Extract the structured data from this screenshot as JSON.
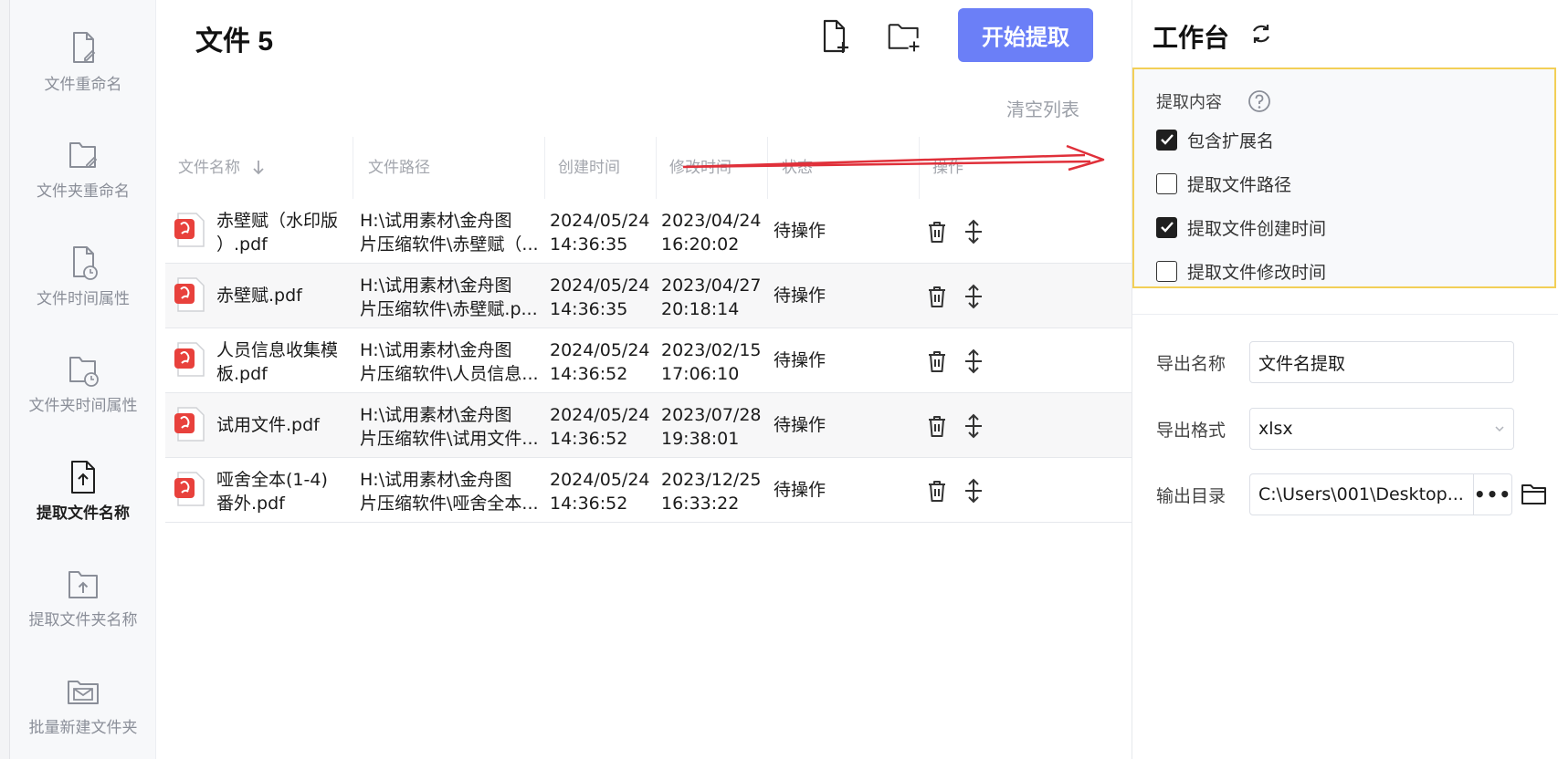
{
  "sidebar": {
    "items": [
      {
        "label": "文件重命名",
        "icon": "file-edit-icon"
      },
      {
        "label": "文件夹重命名",
        "icon": "folder-edit-icon"
      },
      {
        "label": "文件时间属性",
        "icon": "file-clock-icon"
      },
      {
        "label": "文件夹时间属性",
        "icon": "folder-clock-icon"
      },
      {
        "label": "提取文件名称",
        "icon": "file-upload-icon",
        "active": true
      },
      {
        "label": "提取文件夹名称",
        "icon": "folder-upload-icon"
      },
      {
        "label": "批量新建文件夹",
        "icon": "folder-mail-icon"
      }
    ]
  },
  "header": {
    "title": "文件 5",
    "add_file_icon": "add-file-icon",
    "add_folder_icon": "add-folder-icon",
    "start_label": "开始提取",
    "clear_label": "清空列表"
  },
  "table": {
    "columns": [
      "文件名称",
      "文件路径",
      "创建时间",
      "修改时间",
      "状态",
      "操作"
    ],
    "sort_icon": "arrow-down-icon",
    "rows": [
      {
        "name": "赤壁赋（水印版\n）.pdf",
        "path": "H:\\试用素材\\金舟图\n片压缩软件\\赤壁赋（...",
        "created": "2024/05/24\n14:36:35",
        "modified": "2023/04/24\n16:20:02",
        "status": "待操作"
      },
      {
        "name": "赤壁赋.pdf",
        "path": "H:\\试用素材\\金舟图\n片压缩软件\\赤壁赋.p...",
        "created": "2024/05/24\n14:36:35",
        "modified": "2023/04/27\n20:18:14",
        "status": "待操作"
      },
      {
        "name": "人员信息收集模\n板.pdf",
        "path": "H:\\试用素材\\金舟图\n片压缩软件\\人员信息...",
        "created": "2024/05/24\n14:36:52",
        "modified": "2023/02/15\n17:06:10",
        "status": "待操作"
      },
      {
        "name": "试用文件.pdf",
        "path": "H:\\试用素材\\金舟图\n片压缩软件\\试用文件...",
        "created": "2024/05/24\n14:36:52",
        "modified": "2023/07/28\n19:38:01",
        "status": "待操作"
      },
      {
        "name": "哑舍全本(1-4)\n番外.pdf",
        "path": "H:\\试用素材\\金舟图\n片压缩软件\\哑舍全本...",
        "created": "2024/05/24\n14:36:52",
        "modified": "2023/12/25\n16:33:22",
        "status": "待操作"
      }
    ]
  },
  "panel": {
    "title": "工作台",
    "extract_title": "提取内容",
    "options": [
      {
        "label": "包含扩展名",
        "checked": true
      },
      {
        "label": "提取文件路径",
        "checked": false
      },
      {
        "label": "提取文件创建时间",
        "checked": true
      },
      {
        "label": "提取文件修改时间",
        "checked": false
      }
    ],
    "export_name_label": "导出名称",
    "export_name_value": "文件名提取",
    "export_format_label": "导出格式",
    "export_format_value": "xlsx",
    "output_dir_label": "输出目录",
    "output_dir_value": "C:\\Users\\001\\Desktop...",
    "dots_label": "•••"
  },
  "colors": {
    "accent": "#6b7ff7",
    "highlight_border": "#f2cf57",
    "annotation_arrow": "#e0303a",
    "pdf_red": "#e8413c"
  }
}
